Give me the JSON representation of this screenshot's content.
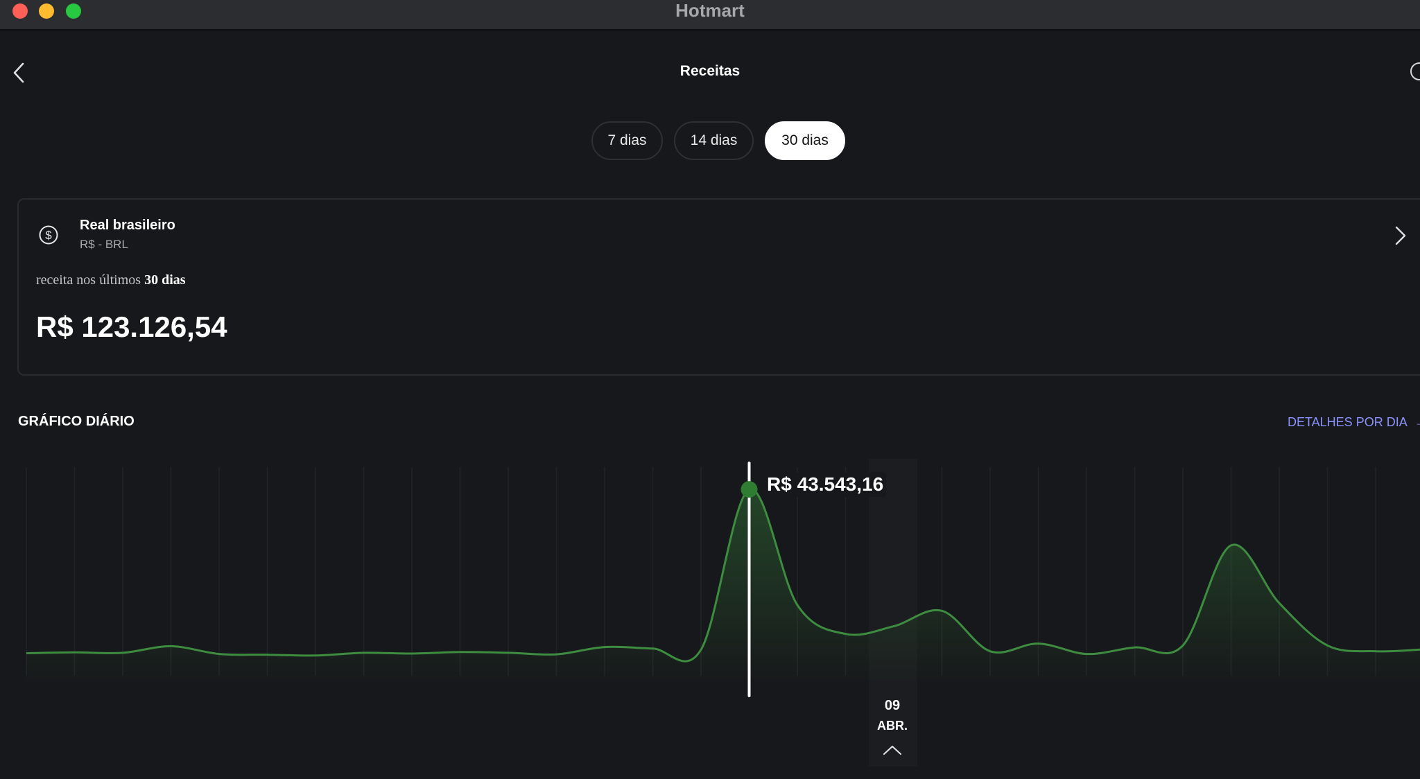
{
  "window": {
    "app_title": "Hotmart"
  },
  "header": {
    "title": "Receitas"
  },
  "periods": [
    {
      "label": "7 dias",
      "selected": false
    },
    {
      "label": "14 dias",
      "selected": false
    },
    {
      "label": "30 dias",
      "selected": true
    }
  ],
  "currency_card": {
    "name": "Real brasileiro",
    "code": "R$ - BRL",
    "period_prefix": "receita nos últimos",
    "period_value": "30 dias",
    "total": "R$ 123.126,54",
    "icon": "dollar-circle-icon"
  },
  "daily_chart": {
    "section_title": "GRÁFICO DIÁRIO",
    "details_link": "DETALHES POR DIA",
    "details_arrow": "→",
    "tooltip_value": "R$ 43.543,16",
    "selected_day": "09",
    "selected_month": "ABR.",
    "line_color": "#3d8c40",
    "marker_color": "#2e7d32"
  },
  "chart_data": {
    "type": "area",
    "x": [
      1,
      2,
      3,
      4,
      5,
      6,
      7,
      8,
      9,
      10,
      11,
      12,
      13,
      14,
      15,
      16,
      17,
      18,
      19,
      20,
      21,
      22,
      23,
      24,
      25,
      26,
      27,
      28,
      29,
      30
    ],
    "values": [
      1000,
      1200,
      1100,
      2800,
      800,
      600,
      400,
      1100,
      900,
      1300,
      1100,
      700,
      2600,
      2200,
      1900,
      43543,
      13500,
      6000,
      8000,
      12000,
      1500,
      3500,
      800,
      2500,
      3000,
      29000,
      14000,
      3000,
      1500,
      2000
    ],
    "selected_index": 15,
    "ylim": [
      0,
      45000
    ]
  }
}
